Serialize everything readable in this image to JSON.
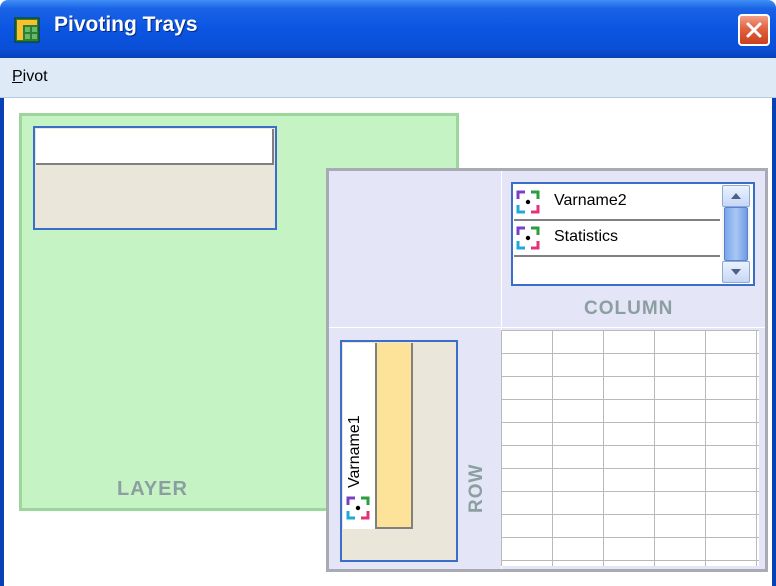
{
  "window": {
    "title": "Pivoting Trays",
    "icons": {
      "app": "pivot-table-icon",
      "close": "close-icon"
    }
  },
  "menubar": {
    "items": [
      {
        "label": "Pivot",
        "mnemonic": "P",
        "rest": "ivot"
      }
    ]
  },
  "trays": {
    "layer": {
      "label": "LAYER",
      "items": []
    },
    "column": {
      "label": "COLUMN",
      "items": [
        {
          "label": "Varname2",
          "icon": "pivot-variable-icon"
        },
        {
          "label": "Statistics",
          "icon": "pivot-variable-icon"
        }
      ]
    },
    "row": {
      "label": "ROW",
      "items": [
        {
          "label": "Varname1",
          "icon": "pivot-variable-icon"
        }
      ]
    }
  },
  "colors": {
    "titlebar": "#0a55e2",
    "layer_tray": "#c6f3c4",
    "pivot_panel": "#e4e5f6",
    "tray_label": "#8c9fa0",
    "selected_item": "#fde29a"
  }
}
